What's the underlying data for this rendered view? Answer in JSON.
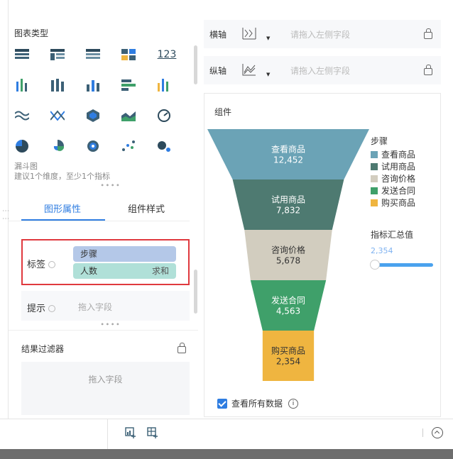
{
  "left_panel": {
    "chart_types_title": "图表类型",
    "kpi_icon_text": "123",
    "funnel_name": "漏斗图",
    "funnel_hint": "建议1个维度，至少1个指标",
    "tabs": [
      "图形属性",
      "组件样式"
    ],
    "label_row": {
      "label": "标签",
      "fields": [
        "步骤",
        "人数"
      ],
      "agg": "求和"
    },
    "hint_row": {
      "label": "提示",
      "placeholder": "拖入字段"
    },
    "filter": {
      "title": "结果过滤器",
      "placeholder": "拖入字段"
    }
  },
  "axes": [
    {
      "name": "横轴",
      "placeholder": "请拖入左侧字段"
    },
    {
      "name": "纵轴",
      "placeholder": "请拖入左侧字段"
    }
  ],
  "card": {
    "title": "组件",
    "legend_title": "步骤",
    "metric_title": "指标汇总值",
    "metric_value": "2,354",
    "show_all_label": "查看所有数据",
    "info_glyph": "i"
  },
  "chart_data": {
    "type": "funnel",
    "series_name": "步骤",
    "stages": [
      {
        "label": "查看商品",
        "value": "12,452",
        "raw": 12452,
        "color": "#6ba3b6"
      },
      {
        "label": "试用商品",
        "value": "7,832",
        "raw": 7832,
        "color": "#4e7a71"
      },
      {
        "label": "咨询价格",
        "value": "5,678",
        "raw": 5678,
        "color": "#d2cdbf"
      },
      {
        "label": "发送合同",
        "value": "4,563",
        "raw": 4563,
        "color": "#3fa06a"
      },
      {
        "label": "购买商品",
        "value": "2,354",
        "raw": 2354,
        "color": "#efb540"
      }
    ]
  },
  "colors": {
    "accent": "#2f7de1",
    "highlight_border": "#e0393e"
  }
}
